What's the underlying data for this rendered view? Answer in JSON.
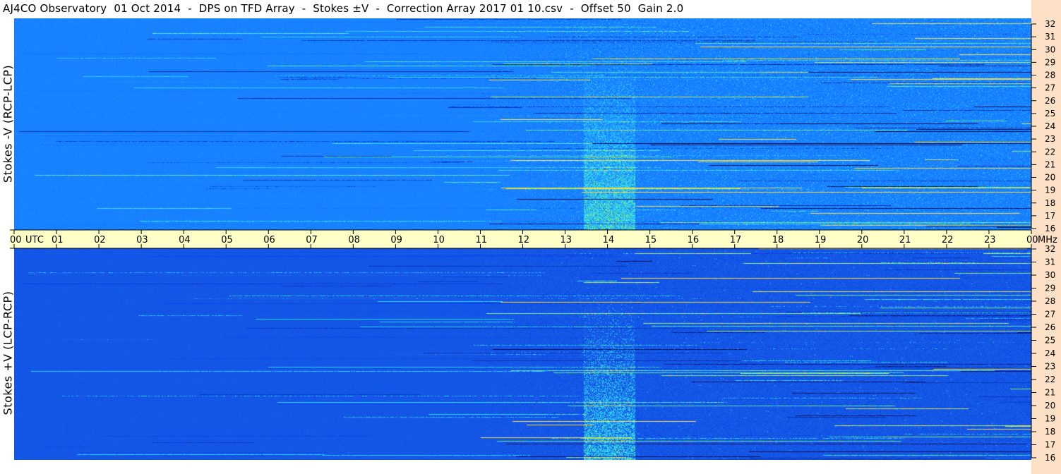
{
  "title": "AJ4CO Observatory  01 Oct 2014  -  DPS on TFD Array  -  Stokes ±V  -  Correction Array 2017 01 10.csv  -  Offset 50  Gain 2.0",
  "colors": {
    "time_axis_bg": "#ffffc8",
    "freq_axis_bg": "#fde0c6",
    "background_top": "#1e82ff",
    "background_bottom": "#1456e6"
  },
  "chart_data": [
    {
      "type": "heatmap",
      "name": "top-panel",
      "ylabel": "Stokes -V (RCP-LCP)",
      "x_unit": "UTC",
      "xlim": [
        0,
        24
      ],
      "ylim": [
        16,
        32
      ],
      "y_unit": "MHz",
      "y_ticks": [
        "32",
        "31",
        "30",
        "29",
        "28",
        "27",
        "26",
        "25",
        "24",
        "23",
        "22",
        "21",
        "20",
        "19",
        "18",
        "17",
        "16"
      ]
    },
    {
      "type": "heatmap",
      "name": "bottom-panel",
      "ylabel": "Stokes +V (LCP-RCP)",
      "x_unit": "UTC",
      "xlim": [
        0,
        24
      ],
      "ylim": [
        16,
        32
      ],
      "y_unit": "MHz",
      "y_ticks": [
        "32",
        "31",
        "30",
        "29",
        "28",
        "27",
        "26",
        "25",
        "24",
        "23",
        "22",
        "21",
        "20",
        "19",
        "18",
        "17",
        "16"
      ]
    }
  ],
  "time_axis": {
    "utc_label": "UTC",
    "mhz_label": "MHz",
    "ticks": [
      "00",
      "01",
      "02",
      "03",
      "04",
      "05",
      "06",
      "07",
      "08",
      "09",
      "10",
      "11",
      "12",
      "13",
      "14",
      "15",
      "16",
      "17",
      "18",
      "19",
      "20",
      "21",
      "22",
      "23",
      "00"
    ]
  }
}
